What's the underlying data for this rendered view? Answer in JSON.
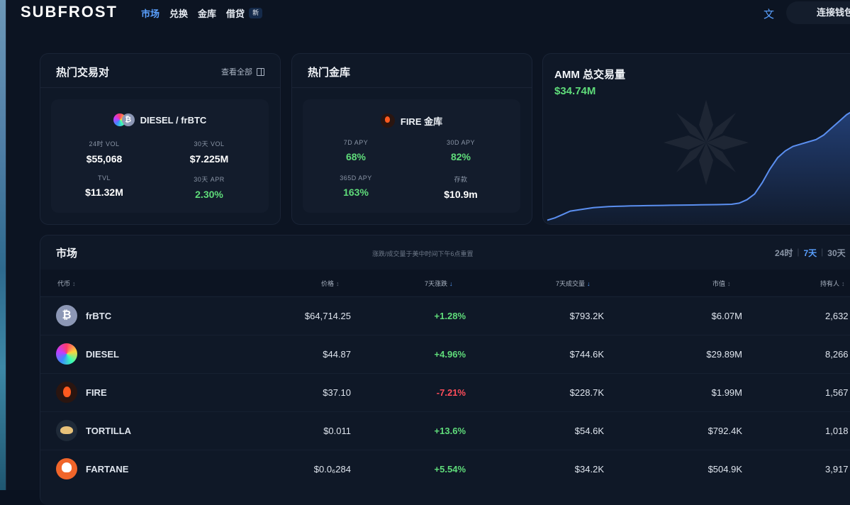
{
  "brand": "SUBFROST",
  "nav": {
    "items": [
      "市场",
      "兑换",
      "金库",
      "借贷"
    ],
    "new_badge": "新"
  },
  "header": {
    "language": "文",
    "connect_wallet": "连接钱包"
  },
  "hot_pairs": {
    "title": "热门交易对",
    "view_all": "查看全部",
    "pair_name": "DIESEL / frBTC",
    "stats": [
      {
        "label": "24时 VOL",
        "value": "$55,068"
      },
      {
        "label": "30天 VOL",
        "value": "$7.225M"
      },
      {
        "label": "TVL",
        "value": "$11.32M"
      },
      {
        "label": "30天 APR",
        "value": "2.30%"
      }
    ]
  },
  "hot_vault": {
    "title": "热门金库",
    "vault_name": "FIRE 金库",
    "stats": [
      {
        "label": "7D APY",
        "value": "68%"
      },
      {
        "label": "30D APY",
        "value": "82%"
      },
      {
        "label": "365D APY",
        "value": "163%"
      },
      {
        "label": "存款",
        "value": "$10.9m"
      }
    ]
  },
  "amm": {
    "title": "AMM 总交易量",
    "value": "$34.74M",
    "chart_data": {
      "type": "area",
      "values": [
        0.01,
        0.03,
        0.06,
        0.09,
        0.1,
        0.11,
        0.12,
        0.125,
        0.13,
        0.132,
        0.134,
        0.136,
        0.137,
        0.138,
        0.139,
        0.14,
        0.141,
        0.142,
        0.143,
        0.144,
        0.145,
        0.146,
        0.147,
        0.148,
        0.15,
        0.16,
        0.19,
        0.24,
        0.34,
        0.46,
        0.56,
        0.62,
        0.66,
        0.68,
        0.7,
        0.72,
        0.76,
        0.82,
        0.88,
        0.94,
        0.98,
        1.0
      ]
    }
  },
  "markets": {
    "title": "市场",
    "note": "涨跌/成交量于美中时间下午6点重置",
    "periods": [
      "24时",
      "7天",
      "30天"
    ],
    "active_period": "7天",
    "columns": [
      "代币",
      "价格",
      "7天涨跌",
      "7天成交量",
      "市值",
      "持有人"
    ],
    "rows": [
      {
        "token": "frBTC",
        "price": "$64,714.25",
        "change": "+1.28%",
        "dir": "up",
        "volume": "$793.2K",
        "mcap": "$6.07M",
        "holders": "2,632",
        "icon": "bitcoin-icon"
      },
      {
        "token": "DIESEL",
        "price": "$44.87",
        "change": "+4.96%",
        "dir": "up",
        "volume": "$744.6K",
        "mcap": "$29.89M",
        "holders": "8,266",
        "icon": "diesel-icon"
      },
      {
        "token": "FIRE",
        "price": "$37.10",
        "change": "-7.21%",
        "dir": "down",
        "volume": "$228.7K",
        "mcap": "$1.99M",
        "holders": "1,567",
        "icon": "fire-icon"
      },
      {
        "token": "TORTILLA",
        "price": "$0.011",
        "change": "+13.6%",
        "dir": "up",
        "volume": "$54.6K",
        "mcap": "$792.4K",
        "holders": "1,018",
        "icon": "tortilla-icon"
      },
      {
        "token": "FARTANE",
        "price": "$0.0₆284",
        "change": "+5.54%",
        "dir": "up",
        "volume": "$34.2K",
        "mcap": "$504.9K",
        "holders": "3,917",
        "icon": "skull-icon"
      }
    ]
  },
  "colors": {
    "accent": "#5aa0ff",
    "positive": "#5fdc7a",
    "negative": "#ff4d5a",
    "background": "#0c1422"
  }
}
